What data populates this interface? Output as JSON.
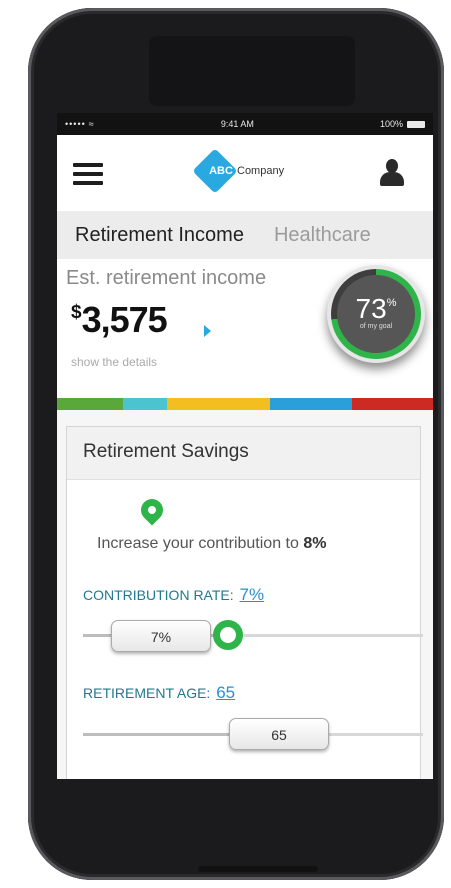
{
  "status_bar": {
    "signal": "•••••",
    "time": "9:41 AM",
    "battery": "100%"
  },
  "header": {
    "logo_abc": "ABC",
    "logo_company": "Company"
  },
  "tabs": [
    {
      "label": "Retirement Income"
    },
    {
      "label": "Healthcare"
    }
  ],
  "income": {
    "label": "Est. retirement income",
    "currency_symbol": "$",
    "amount": "3,575",
    "details_link": "show the details",
    "goal_percent": "73",
    "goal_percent_sign": "%",
    "goal_caption": "of my goal",
    "goal_fraction": 0.73
  },
  "colors": {
    "accent_blue": "#2aa8e0",
    "accent_green": "#2fb44a",
    "label_teal": "#1f7a8c",
    "bar_segments": [
      "#5aa83a",
      "#4cc4cf",
      "#f3be1f",
      "#2b9fd9",
      "#cc2a22"
    ]
  },
  "savings": {
    "title": "Retirement Savings",
    "tip_prefix": "Increase your contribution to ",
    "tip_value": "8%",
    "contribution": {
      "label": "CONTRIBUTION RATE:",
      "value": "7%",
      "slider_text": "7%"
    },
    "retirement_age": {
      "label": "RETIREMENT AGE:",
      "value": "65",
      "slider_text": "65"
    }
  }
}
